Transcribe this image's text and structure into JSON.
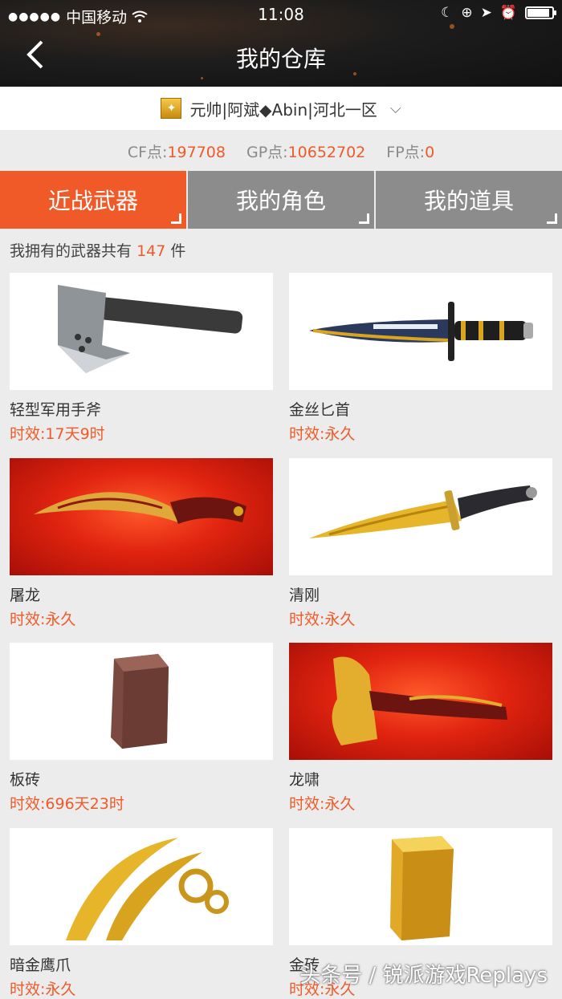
{
  "status_bar": {
    "carrier": "中国移动",
    "time": "11:08",
    "battery_level": 0.9
  },
  "nav": {
    "back_icon": "chevron-left-icon",
    "title": "我的仓库"
  },
  "account": {
    "label": "元帅|阿斌◆Abin|河北一区",
    "icon": "rank-badge-icon"
  },
  "points": {
    "cf_label": "CF点:",
    "cf_value": "197708",
    "gp_label": "GP点:",
    "gp_value": "10652702",
    "fp_label": "FP点:",
    "fp_value": "0"
  },
  "tabs": [
    {
      "label": "近战武器",
      "active": true
    },
    {
      "label": "我的角色",
      "active": false
    },
    {
      "label": "我的道具",
      "active": false
    }
  ],
  "count": {
    "prefix": "我拥有的武器共有",
    "number": "147",
    "suffix": "件"
  },
  "items": [
    {
      "name": "轻型军用手斧",
      "validity": "时效:17天9时",
      "image": "tomahawk-image"
    },
    {
      "name": "金丝匕首",
      "validity": "时效:永久",
      "image": "gold-dagger-image"
    },
    {
      "name": "屠龙",
      "validity": "时效:永久",
      "image": "dragon-kukri-image"
    },
    {
      "name": "清刚",
      "validity": "时效:永久",
      "image": "gold-knife-image"
    },
    {
      "name": "板砖",
      "validity": "时效:696天23时",
      "image": "brick-image"
    },
    {
      "name": "龙啸",
      "validity": "时效:永久",
      "image": "dragon-axe-image"
    },
    {
      "name": "暗金鹰爪",
      "validity": "时效:永久",
      "image": "gold-karambit-image"
    },
    {
      "name": "金砖",
      "validity": "时效:永久",
      "image": "gold-brick-image"
    }
  ],
  "watermark": "头条号 / 锐派游戏Replays",
  "colors": {
    "accent": "#f05a28",
    "tab_inactive": "#8c8c8c",
    "background": "#ececec"
  }
}
